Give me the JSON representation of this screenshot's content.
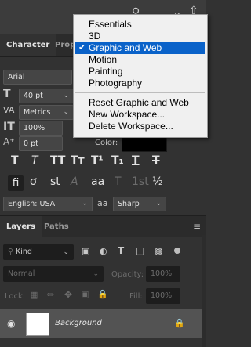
{
  "workspace_menu": {
    "items": [
      {
        "label": "Essentials",
        "checked": false,
        "selected": false
      },
      {
        "label": "3D",
        "checked": false,
        "selected": false
      },
      {
        "label": "Graphic and Web",
        "checked": true,
        "selected": true
      },
      {
        "label": "Motion",
        "checked": false,
        "selected": false
      },
      {
        "label": "Painting",
        "checked": false,
        "selected": false
      },
      {
        "label": "Photography",
        "checked": false,
        "selected": false
      }
    ],
    "actions": [
      "Reset Graphic and Web",
      "New Workspace...",
      "Delete Workspace..."
    ]
  },
  "character_panel": {
    "tabs": [
      "Character",
      "Prop"
    ],
    "font_family": "Arial",
    "font_size": "40 pt",
    "kerning": "Metrics",
    "vertical_scale": "100%",
    "baseline_shift": "0 pt",
    "color_label": "Color:",
    "style_buttons": [
      "T",
      "T",
      "TT",
      "Tт",
      "T¹",
      "T₁",
      "T",
      "T"
    ],
    "opentype_buttons": [
      "fi",
      "ơ",
      "st",
      "A",
      "aa",
      "T",
      "1st",
      "½"
    ],
    "language": "English: USA",
    "aa_label": "aa",
    "antialias": "Sharp"
  },
  "layers_panel": {
    "tabs": [
      "Layers",
      "Paths"
    ],
    "filter_label": "Kind",
    "blend_mode": "Normal",
    "opacity_label": "Opacity:",
    "opacity_value": "100%",
    "lock_label": "Lock:",
    "fill_label": "Fill:",
    "fill_value": "100%",
    "layer_name": "Background"
  },
  "colors": {
    "menu_highlight": "#0a62c9",
    "panel_bg": "#323232",
    "swatch": "#000000"
  }
}
